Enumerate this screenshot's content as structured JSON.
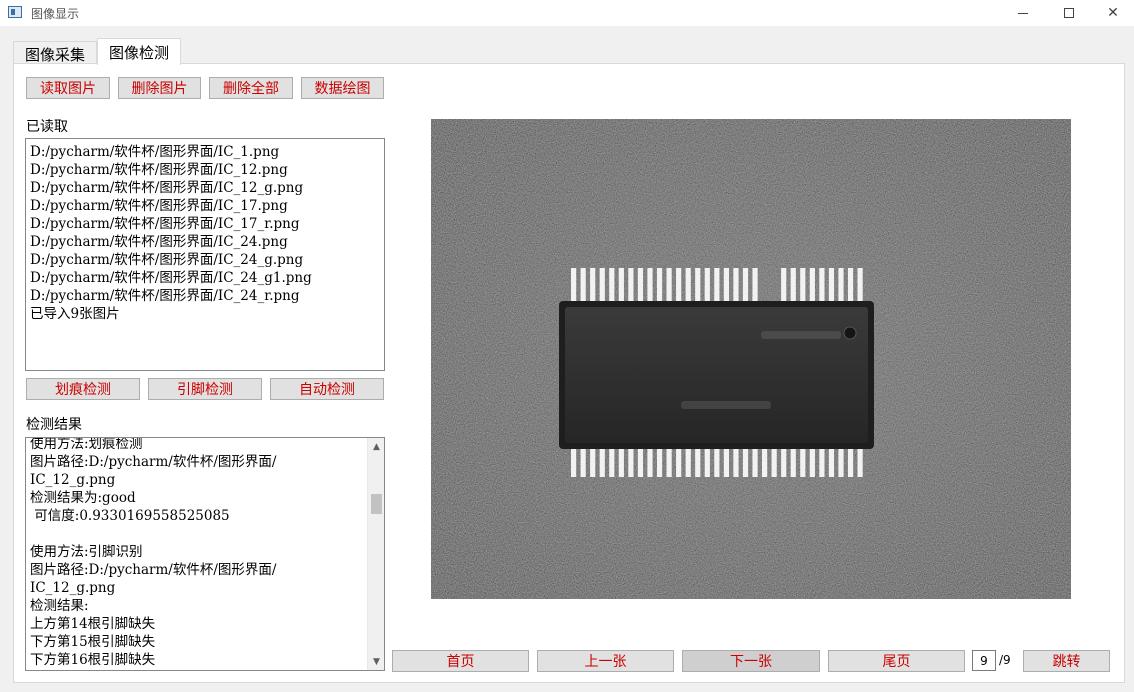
{
  "window": {
    "title": "图像显示"
  },
  "tabs": [
    {
      "label": "图像采集"
    },
    {
      "label": "图像检测"
    }
  ],
  "toolbar": {
    "read_label": "读取图片",
    "delete_label": "删除图片",
    "delete_all_label": "删除全部",
    "plot_label": "数据绘图"
  },
  "loaded": {
    "heading": "已读取",
    "lines": [
      "D:/pycharm/软件杯/图形界面/IC_1.png",
      "D:/pycharm/软件杯/图形界面/IC_12.png",
      "D:/pycharm/软件杯/图形界面/IC_12_g.png",
      "D:/pycharm/软件杯/图形界面/IC_17.png",
      "D:/pycharm/软件杯/图形界面/IC_17_r.png",
      "D:/pycharm/软件杯/图形界面/IC_24.png",
      "D:/pycharm/软件杯/图形界面/IC_24_g.png",
      "D:/pycharm/软件杯/图形界面/IC_24_g1.png",
      "D:/pycharm/软件杯/图形界面/IC_24_r.png",
      "已导入9张图片"
    ]
  },
  "detect_buttons": {
    "scratch_label": "划痕检测",
    "pin_label": "引脚检测",
    "auto_label": "自动检测"
  },
  "results": {
    "heading": "检测结果",
    "lines": [
      "使用方法:划痕检测",
      "图片路径:D:/pycharm/软件杯/图形界面/",
      "IC_12_g.png",
      "检测结果为:good",
      " 可信度:0.9330169558525085",
      "",
      "使用方法:引脚识别",
      "图片路径:D:/pycharm/软件杯/图形界面/",
      "IC_12_g.png",
      "检测结果:",
      "上方第14根引脚缺失",
      "下方第15根引脚缺失",
      "下方第16根引脚缺失"
    ]
  },
  "navigation": {
    "first_label": "首页",
    "prev_label": "上一张",
    "next_label": "下一张",
    "last_label": "尾页",
    "page_value": "9",
    "page_total": "/9",
    "jump_label": "跳转"
  },
  "icons": {
    "app": "app-window-icon",
    "minimize": "minimize-icon",
    "maximize": "maximize-icon",
    "close": "close-icon",
    "scroll_up": "scroll-up-arrow-icon",
    "scroll_down": "scroll-down-arrow-icon"
  },
  "image": {
    "description_colors": {
      "background": "#5a5a5a",
      "chip_body": "#2e2e2e",
      "pins": "#f2f2f2"
    }
  }
}
